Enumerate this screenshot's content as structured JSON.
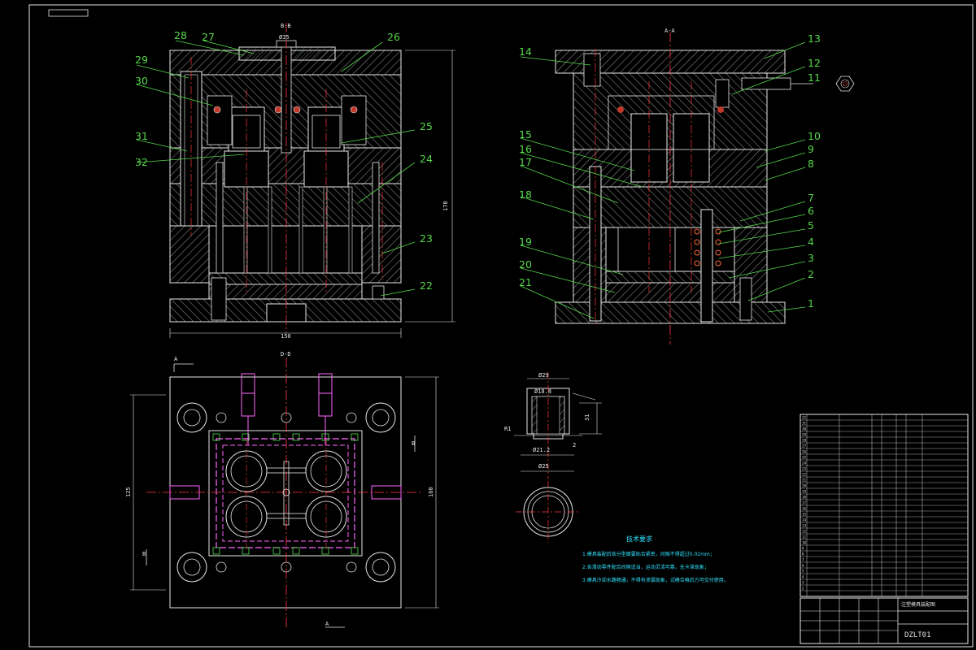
{
  "drawing": {
    "part_labels_left": [
      "28",
      "27",
      "26",
      "29",
      "30",
      "25",
      "31",
      "24",
      "32",
      "23",
      "22"
    ],
    "part_labels_right": [
      "14",
      "13",
      "12",
      "11",
      "10",
      "9",
      "8",
      "7",
      "6",
      "5",
      "4",
      "3",
      "2",
      "1",
      "15",
      "16",
      "17",
      "18",
      "19",
      "20",
      "21"
    ],
    "dimensions": {
      "front_width": "150",
      "front_height": "178",
      "plan_width": "125",
      "plan_height": "160",
      "sprue_dia": "Ø35",
      "part_top_dia": "Ø29",
      "part_inner_dia": "Ø18.8",
      "part_bottom_dia": "Ø21.2",
      "part_outer_dia": "Ø25",
      "part_height": "31",
      "part_step": "2",
      "part_fillet": "R1"
    },
    "section_marks": {
      "front": "B-B",
      "side": "A-A",
      "plan_top": "D-D",
      "plan_a": "A",
      "plan_b": "B"
    },
    "tech_title": "技术要求",
    "tech_notes": [
      "1.模具装配后各分型面要贴合紧密，间隙不得超过0.02mm；",
      "2.各滑动零件配合间隙适当，运动灵活可靠，无卡滞现象；",
      "3.模具冷却水路畅通，不得有渗漏现象，试模合格后方可交付使用。"
    ],
    "drawing_number": "DZLT01",
    "title_block_head": "注塑模具装配图"
  },
  "colors": {
    "background": "#000000",
    "outline": "#e8e8e8",
    "hatch": "#ffffff",
    "label": "#55d84a",
    "centerline": "#ff3b3b",
    "cooling": "#ff66ff",
    "note": "#2fe3ff"
  }
}
